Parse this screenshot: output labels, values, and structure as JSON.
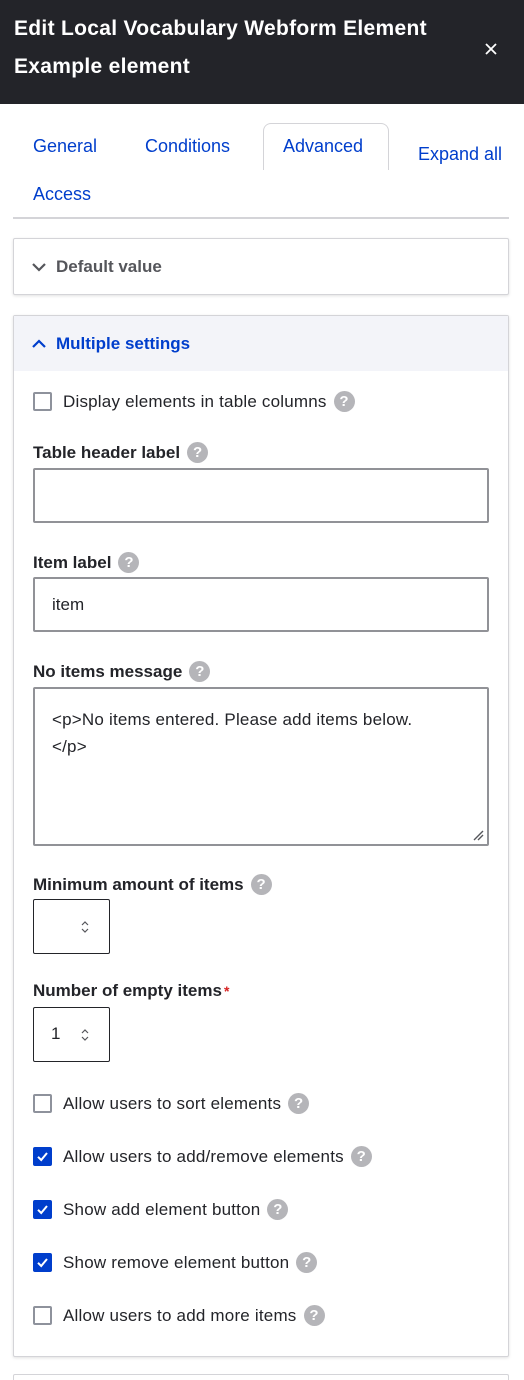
{
  "dialog": {
    "title": "Edit Local Vocabulary Webform Element Example element",
    "close_icon": "close-icon"
  },
  "tabs": {
    "items": [
      "General",
      "Conditions",
      "Advanced",
      "Access"
    ],
    "active": "Advanced",
    "expand_all": "Expand all"
  },
  "sections": {
    "default_value": {
      "label": "Default value",
      "expanded": false
    },
    "multiple_settings": {
      "label": "Multiple settings",
      "expanded": true
    }
  },
  "fields": {
    "display_in_table": {
      "label": "Display elements in table columns",
      "checked": false
    },
    "table_header_label": {
      "label": "Table header label",
      "value": ""
    },
    "item_label": {
      "label": "Item label",
      "value": "item"
    },
    "no_items_message": {
      "label": "No items message",
      "value": "<p>No items entered. Please add items below.\n</p>"
    },
    "min_items": {
      "label": "Minimum amount of items",
      "value": ""
    },
    "empty_items": {
      "label": "Number of empty items",
      "required_marker": "*",
      "value": "1"
    },
    "sorting": {
      "label": "Allow users to sort elements",
      "checked": false
    },
    "operations": {
      "label": "Allow users to add/remove elements",
      "checked": true
    },
    "add_button": {
      "label": "Show add element button",
      "checked": true
    },
    "remove_button": {
      "label": "Show remove element button",
      "checked": true
    },
    "add_more": {
      "label": "Allow users to add more items",
      "checked": false
    }
  },
  "help_icon_glyph": "?",
  "colors": {
    "header_bg": "#232429",
    "accent": "#003ecc",
    "border": "#d4d4d8",
    "required": "#d72222"
  }
}
